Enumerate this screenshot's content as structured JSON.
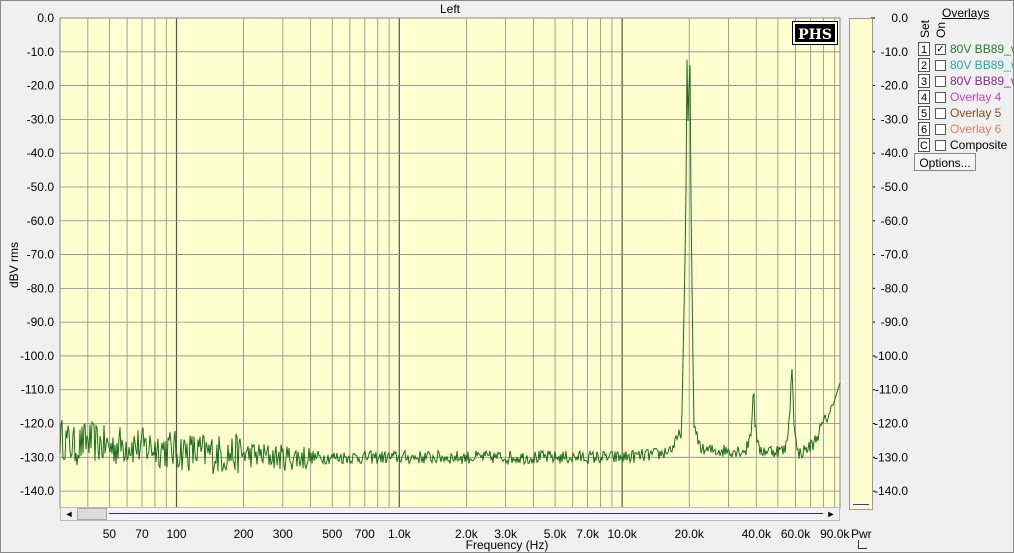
{
  "chart_data": {
    "type": "line",
    "title": "Left",
    "xlabel": "Frequency (Hz)",
    "ylabel": "dBV rms",
    "x_scale": "log",
    "xlim": [
      30,
      95000
    ],
    "ylim": [
      -145,
      0
    ],
    "x_ticks": [
      50,
      70,
      100,
      200,
      300,
      500,
      700,
      1000,
      2000,
      3000,
      5000,
      7000,
      10000,
      20000,
      40000,
      60000,
      90000
    ],
    "x_tick_labels": [
      "50",
      "70",
      "100",
      "200",
      "300",
      "500",
      "700",
      "1.0k",
      "2.0k",
      "3.0k",
      "5.0k",
      "7.0k",
      "10.0k",
      "20.0k",
      "40.0k",
      "60.0k",
      "90.0k"
    ],
    "y_ticks": [
      0,
      -10,
      -20,
      -30,
      -40,
      -50,
      -60,
      -70,
      -80,
      -90,
      -100,
      -110,
      -120,
      -130,
      -140
    ],
    "y_tick_labels": [
      "0.0",
      "-10.0",
      "-20.0",
      "-30.0",
      "-40.0",
      "-50.0",
      "-60.0",
      "-70.0",
      "-80.0",
      "-90.0",
      "-100.0",
      "-110.0",
      "-120.0",
      "-130.0",
      "-140.0"
    ],
    "grid": true,
    "background_color": "#ffffd0",
    "series": [
      {
        "name": "80V BB89_v",
        "color": "#1a6e1a",
        "points": [
          [
            30,
            -124
          ],
          [
            35,
            -127
          ],
          [
            40,
            -125
          ],
          [
            45,
            -126
          ],
          [
            50,
            -127
          ],
          [
            60,
            -126
          ],
          [
            70,
            -127
          ],
          [
            80,
            -127
          ],
          [
            100,
            -128
          ],
          [
            150,
            -129
          ],
          [
            200,
            -129
          ],
          [
            300,
            -130
          ],
          [
            500,
            -130
          ],
          [
            700,
            -130
          ],
          [
            1000,
            -130
          ],
          [
            2000,
            -130
          ],
          [
            3000,
            -130
          ],
          [
            5000,
            -130
          ],
          [
            7000,
            -130
          ],
          [
            10000,
            -130
          ],
          [
            15000,
            -129
          ],
          [
            17000,
            -127
          ],
          [
            18500,
            -122
          ],
          [
            19300,
            -60
          ],
          [
            19600,
            -2
          ],
          [
            19800,
            -40
          ],
          [
            20100,
            -2
          ],
          [
            20400,
            -60
          ],
          [
            21000,
            -122
          ],
          [
            23000,
            -128
          ],
          [
            30000,
            -128
          ],
          [
            36000,
            -128
          ],
          [
            38000,
            -122
          ],
          [
            38900,
            -108
          ],
          [
            39500,
            -120
          ],
          [
            41000,
            -128
          ],
          [
            50000,
            -128
          ],
          [
            54000,
            -128
          ],
          [
            56500,
            -118
          ],
          [
            57700,
            -102
          ],
          [
            59000,
            -118
          ],
          [
            61000,
            -129
          ],
          [
            66000,
            -128
          ],
          [
            72000,
            -126
          ],
          [
            80000,
            -120
          ],
          [
            88000,
            -115
          ],
          [
            95000,
            -108
          ]
        ]
      }
    ]
  },
  "panel": {
    "overlays_title": "Overlays",
    "col_set": "Set",
    "col_on": "On",
    "options_label": "Options...",
    "pwr_label": "Pwr",
    "logo_text": "PHS",
    "overlays": [
      {
        "set": "1",
        "checked": true,
        "label": "80V BB89_v",
        "color": "#2a7a2a"
      },
      {
        "set": "2",
        "checked": false,
        "label": "80V BB89_v",
        "color": "#29a6a6"
      },
      {
        "set": "3",
        "checked": false,
        "label": "80V BB89_v",
        "color": "#8a2a8a"
      },
      {
        "set": "4",
        "checked": false,
        "label": "Overlay 4",
        "color": "#d040d0"
      },
      {
        "set": "5",
        "checked": false,
        "label": "Overlay 5",
        "color": "#805020"
      },
      {
        "set": "6",
        "checked": false,
        "label": "Overlay 6",
        "color": "#e08060"
      },
      {
        "set": "C",
        "checked": false,
        "label": "Composite",
        "color": "#000000"
      }
    ]
  },
  "scrollbar": {
    "left_arrow": "◄",
    "right_arrow": "►"
  }
}
